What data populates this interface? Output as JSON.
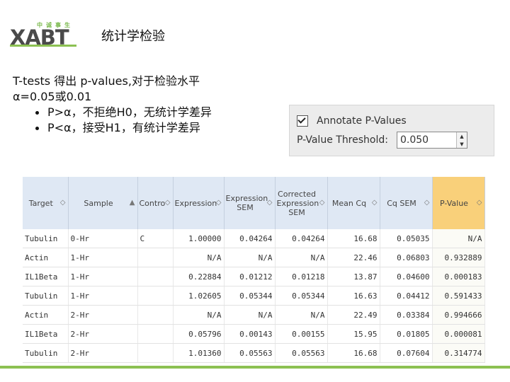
{
  "logo": {
    "word": "XABT",
    "cn": "中诚事生"
  },
  "title": "统计学检验",
  "body_text": {
    "line1": "T-tests 得出 p-values,对于检验水平",
    "line2": "α=0.05或0.01",
    "bullets": [
      "P>α，不拒绝H0，无统计学差异",
      "P<α，接受H1，有统计学差异"
    ]
  },
  "panel": {
    "annotate_label": "Annotate P-Values",
    "annotate_checked": true,
    "threshold_label": "P-Value Threshold:",
    "threshold_value": "0.050"
  },
  "table": {
    "headers": [
      "Target",
      "Sample",
      "Contro",
      "Expression",
      "Expression SEM",
      "Corrected Expression SEM",
      "Mean Cq",
      "Cq SEM",
      "P-Value"
    ],
    "rows": [
      [
        "Tubulin",
        "0-Hr",
        "C",
        "1.00000",
        "0.04264",
        "0.04264",
        "16.68",
        "0.05035",
        "N/A"
      ],
      [
        "Actin",
        "1-Hr",
        "",
        "N/A",
        "N/A",
        "N/A",
        "22.46",
        "0.06803",
        "0.932889"
      ],
      [
        "IL1Beta",
        "1-Hr",
        "",
        "0.22884",
        "0.01212",
        "0.01218",
        "13.87",
        "0.04600",
        "0.000183"
      ],
      [
        "Tubulin",
        "1-Hr",
        "",
        "1.02605",
        "0.05344",
        "0.05344",
        "16.63",
        "0.04412",
        "0.591433"
      ],
      [
        "Actin",
        "2-Hr",
        "",
        "N/A",
        "N/A",
        "N/A",
        "22.49",
        "0.03384",
        "0.994666"
      ],
      [
        "IL1Beta",
        "2-Hr",
        "",
        "0.05796",
        "0.00143",
        "0.00155",
        "15.95",
        "0.01805",
        "0.000081"
      ],
      [
        "Tubulin",
        "2-Hr",
        "",
        "1.01360",
        "0.05563",
        "0.05563",
        "16.68",
        "0.07604",
        "0.314774"
      ]
    ]
  },
  "colors": {
    "accent_green": "#8cc152",
    "header_blue": "#dfe8f4",
    "pvalue_header": "#f9d07a"
  }
}
